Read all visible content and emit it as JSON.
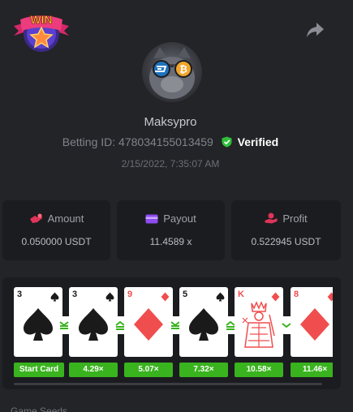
{
  "header": {
    "logo_text": "WIN",
    "logo_icon": "star-badge-icon",
    "share_icon": "share-arrow-icon"
  },
  "profile": {
    "username": "Maksypro",
    "betting_id_label": "Betting ID:",
    "betting_id": "478034155013459",
    "verified_label": "Verified",
    "timestamp": "2/15/2022, 7:35:07 AM",
    "avatar_badges": [
      "dash-coin-icon",
      "bitcoin-icon"
    ]
  },
  "stats": [
    {
      "label": "Amount",
      "value": "0.050000 USDT",
      "icon": "hand-money-icon"
    },
    {
      "label": "Payout",
      "value": "11.4589 x",
      "icon": "wallet-icon"
    },
    {
      "label": "Profit",
      "value": "0.522945 USDT",
      "icon": "profit-hand-icon"
    }
  ],
  "cards": [
    {
      "rank": "3",
      "suit": "spades",
      "multiplier": "Start Card"
    },
    {
      "rank": "3",
      "suit": "spades",
      "multiplier": "4.29×",
      "guess": "lower-or-same"
    },
    {
      "rank": "9",
      "suit": "diamonds",
      "multiplier": "5.07×",
      "guess": "higher-or-same"
    },
    {
      "rank": "5",
      "suit": "spades",
      "multiplier": "7.32×",
      "guess": "lower-or-same"
    },
    {
      "rank": "K",
      "suit": "diamonds",
      "multiplier": "10.58×",
      "guess": "higher-or-same"
    },
    {
      "rank": "8",
      "suit": "diamonds",
      "multiplier": "11.46×",
      "guess": "lower"
    }
  ],
  "colors": {
    "background": "#232427",
    "panel": "#1b1c1f",
    "accent_green": "#39b31e",
    "card_red": "#f04e4e",
    "card_black": "#1a1a1a",
    "stat_icon": "#e0345a",
    "wallet_icon": "#8e4bf0"
  },
  "next_section": {
    "title": "Game Seeds"
  }
}
